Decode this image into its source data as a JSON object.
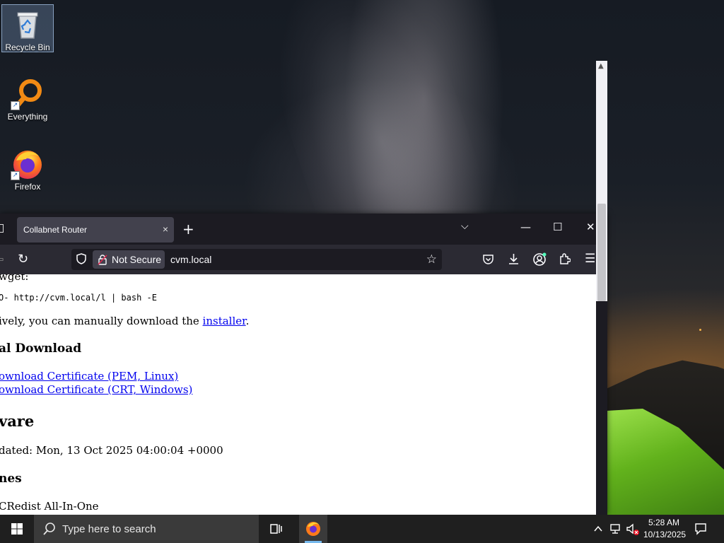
{
  "desktop": {
    "icons": [
      {
        "label": "Recycle Bin",
        "icon": "recycle-bin-icon"
      },
      {
        "label": "Everything",
        "icon": "everything-search-icon"
      },
      {
        "label": "Firefox",
        "icon": "firefox-icon"
      }
    ]
  },
  "browser": {
    "tab": {
      "title": "Collabnet Router",
      "close": "×"
    },
    "new_tab": "+",
    "window_controls": {
      "list_tabs": "⌵",
      "minimize": "—",
      "maximize": "☐",
      "close": "✕"
    },
    "toolbar": {
      "back": "⇦",
      "reload": "↻",
      "not_secure": "Not Secure",
      "url": "cvm.local",
      "bookmark_star": "☆",
      "menu": "☰"
    },
    "page": {
      "line1": "wget:",
      "command": "O- http://cvm.local/l | bash -E",
      "manual_prefix": "ively, you can manually download the ",
      "installer_link": "installer",
      "manual_suffix": ".",
      "cert_heading": "al Download",
      "cert_link_pem": "ownload Certificate (PEM, Linux)",
      "cert_link_crt": "ownload Certificate (CRT, Windows)",
      "software_heading": "vare",
      "updated": "dated: Mon, 13 Oct 2025 04:00:04 +0000",
      "runtimes_heading": "nes",
      "vcredist": "CRedist All-In-One"
    }
  },
  "taskbar": {
    "search_placeholder": "Type here to search",
    "time": "5:28 AM",
    "date": "10/13/2025"
  },
  "colors": {
    "browser_frame": "#1c1b22",
    "browser_toolbar": "#2b2a33",
    "active_tab": "#42414d",
    "link": "#0000ee",
    "taskbar": "#1f1f1f"
  }
}
